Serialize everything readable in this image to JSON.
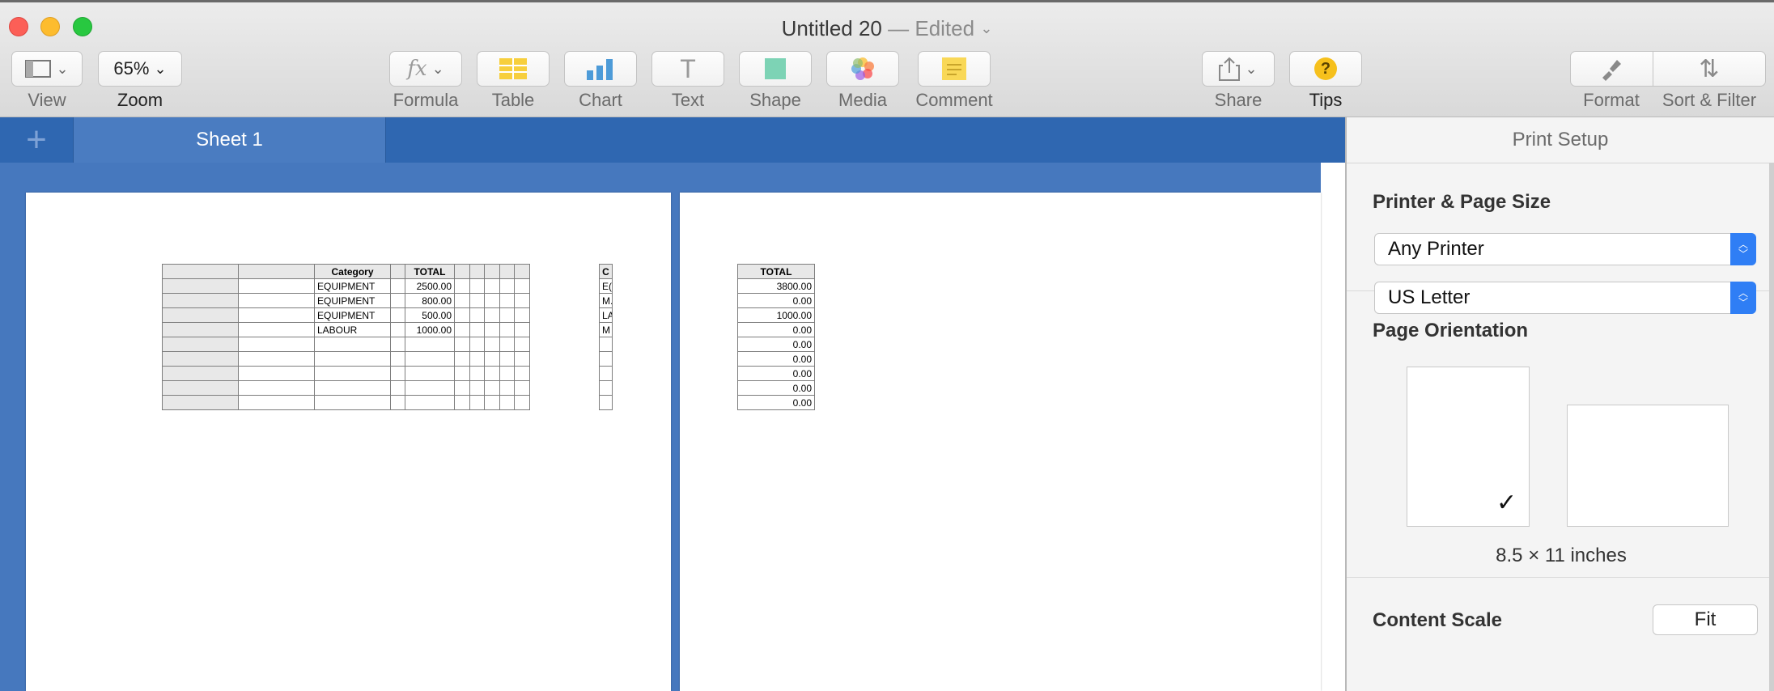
{
  "window": {
    "title": "Untitled 20",
    "edited": "— Edited",
    "chevron": "⌄"
  },
  "toolbar": {
    "view_label": "View",
    "zoom_value": "65%",
    "zoom_label": "Zoom",
    "formula_label": "Formula",
    "formula_glyph": "fx",
    "table_label": "Table",
    "chart_label": "Chart",
    "text_label": "Text",
    "text_glyph": "T",
    "shape_label": "Shape",
    "media_label": "Media",
    "comment_label": "Comment",
    "share_label": "Share",
    "tips_label": "Tips",
    "tips_glyph": "?",
    "format_label": "Format",
    "sort_filter_label": "Sort & Filter",
    "sort_glyph": "⇅",
    "icons": [
      "view-icon",
      "formula-icon",
      "table-icon",
      "chart-icon",
      "text-icon",
      "shape-icon",
      "media-icon",
      "comment-icon",
      "share-icon",
      "tips-icon",
      "format-icon",
      "sort-filter-icon"
    ]
  },
  "sheets": {
    "add_glyph": "+",
    "tabs": [
      {
        "label": "Sheet 1"
      }
    ]
  },
  "page1": {
    "table": {
      "headers": [
        "",
        "",
        "Category",
        "",
        "TOTAL",
        "",
        "",
        "",
        "",
        ""
      ],
      "rows": [
        [
          "EQUIPMENT",
          "2500.00"
        ],
        [
          "EQUIPMENT",
          "800.00"
        ],
        [
          "EQUIPMENT",
          "500.00"
        ],
        [
          "LABOUR",
          "1000.00"
        ],
        [
          "",
          ""
        ],
        [
          "",
          ""
        ],
        [
          "",
          ""
        ],
        [
          "",
          ""
        ],
        [
          "",
          ""
        ]
      ]
    },
    "clipped_table": {
      "header": "C",
      "rows": [
        "E(",
        "M.",
        "LA",
        "M",
        "",
        "",
        "",
        "",
        ""
      ]
    }
  },
  "page2": {
    "table": {
      "header": "TOTAL",
      "rows": [
        "3800.00",
        "0.00",
        "1000.00",
        "0.00",
        "0.00",
        "0.00",
        "0.00",
        "0.00",
        "0.00"
      ]
    }
  },
  "panel": {
    "title": "Print Setup",
    "printer_section": "Printer & Page Size",
    "printer_value": "Any Printer",
    "paper_value": "US Letter",
    "orientation_section": "Page Orientation",
    "selected_orientation": "portrait",
    "check_glyph": "✓",
    "page_size_label": "8.5 × 11 inches",
    "content_scale_section": "Content Scale",
    "fit_label": "Fit"
  },
  "colors": {
    "accent": "#2f7ef5",
    "sheet_bar": "#2f67b1",
    "canvas": "#4678be"
  }
}
